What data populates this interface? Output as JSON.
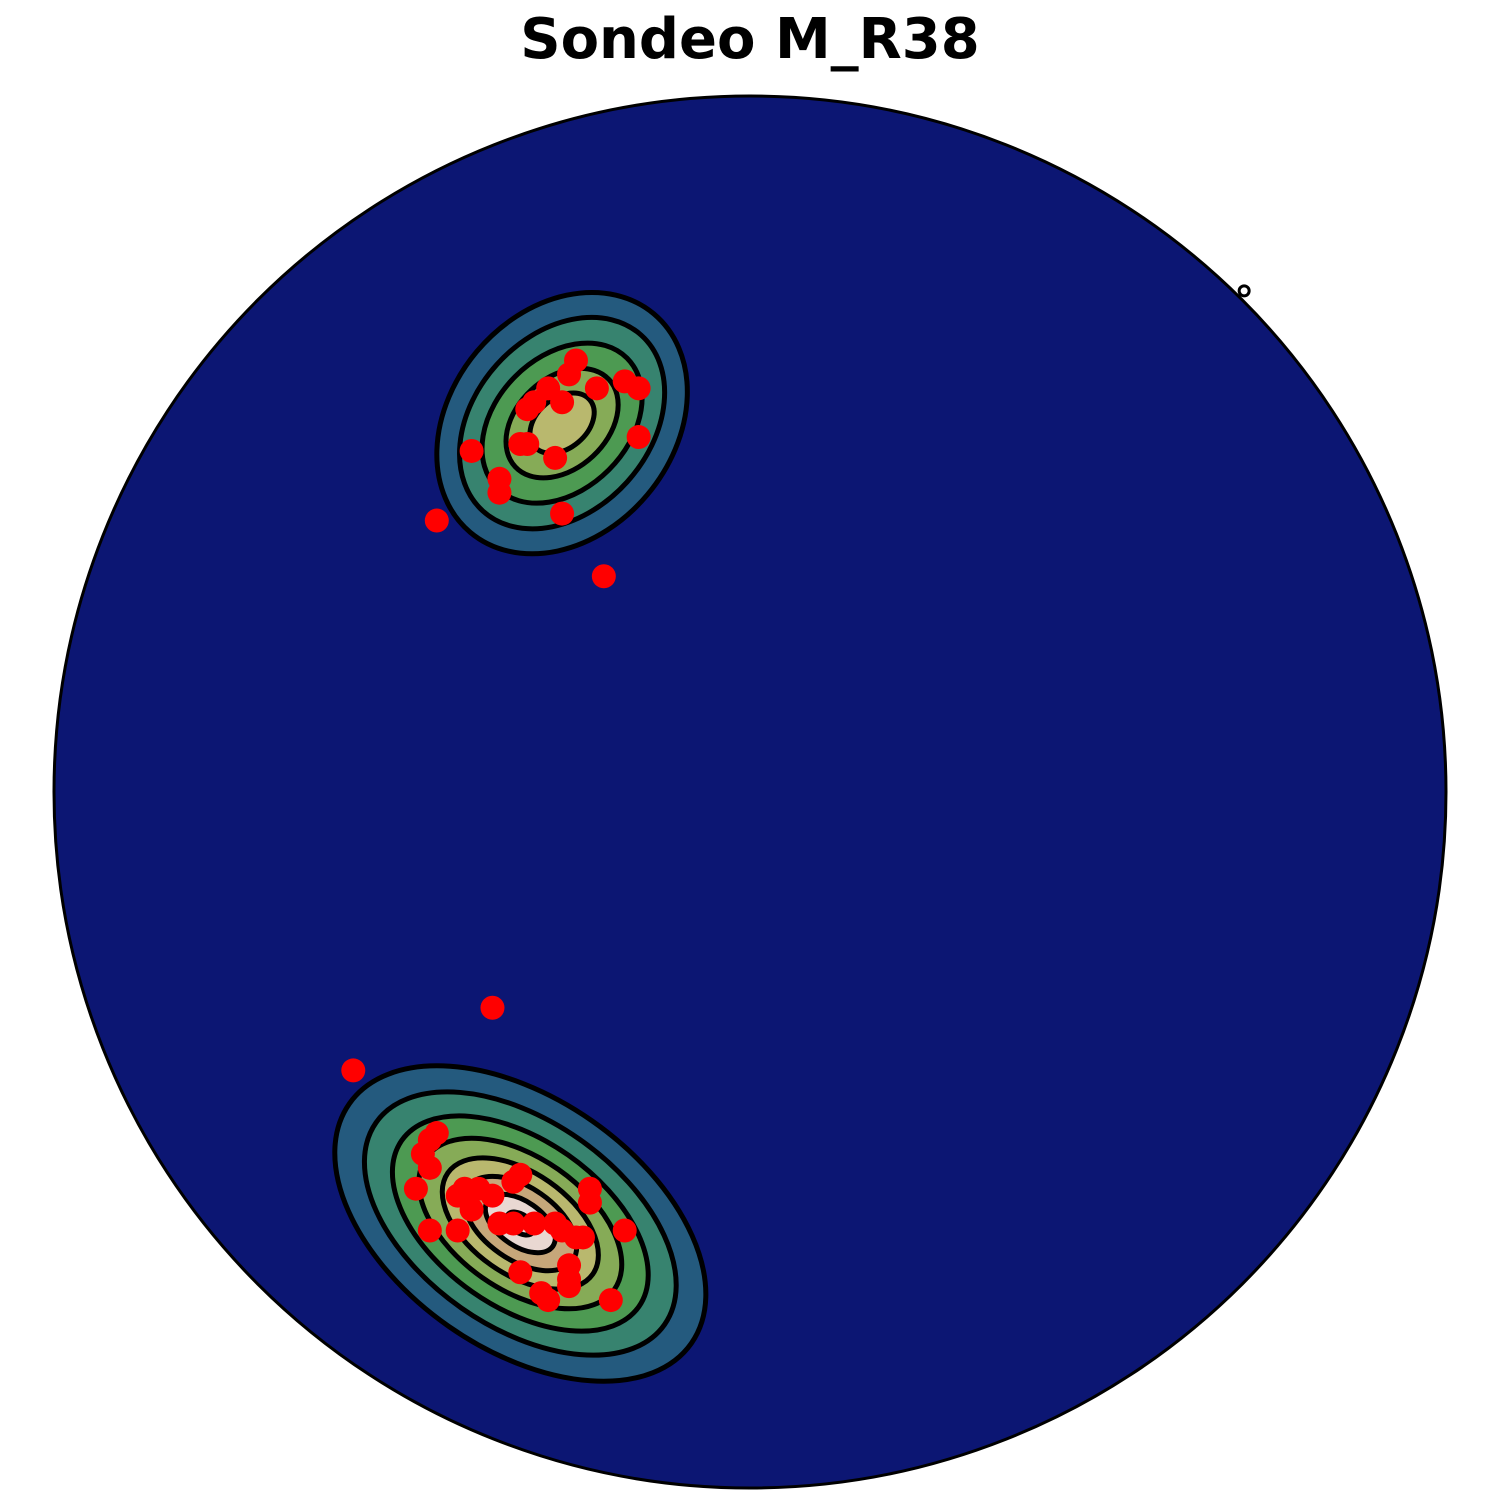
{
  "chart_data": {
    "type": "scatter",
    "projection": "stereonet",
    "title": "Sondeo M_R38",
    "xlabel": "",
    "ylabel": "",
    "xlim": [
      -1,
      1
    ],
    "ylim": [
      -1,
      1
    ],
    "grid": false,
    "legend": "none",
    "colors": {
      "background": "#0c1673",
      "poles": "#ff0000",
      "contour_line": "#000000",
      "net_outline": "#000000",
      "density_levels": [
        "#0c1673",
        "#245a7e",
        "#37836f",
        "#4d9a52",
        "#86ab57",
        "#b9b86e",
        "#c6a77a",
        "#e9d8d2"
      ]
    },
    "north_marker": {
      "x": 0.71,
      "y": 0.72
    },
    "density_clusters": [
      {
        "name": "cluster-north",
        "center": [
          -0.27,
          0.53
        ],
        "levels": [
          {
            "rx": 0.205,
            "ry": 0.16,
            "rot": -50
          },
          {
            "rx": 0.17,
            "ry": 0.126,
            "rot": -48
          },
          {
            "rx": 0.132,
            "ry": 0.095,
            "rot": -45
          },
          {
            "rx": 0.092,
            "ry": 0.065,
            "rot": -43
          },
          {
            "rx": 0.052,
            "ry": 0.036,
            "rot": -40
          }
        ]
      },
      {
        "name": "cluster-south",
        "center": [
          -0.33,
          -0.62
        ],
        "levels": [
          {
            "rx": 0.3,
            "ry": 0.18,
            "rot": 35
          },
          {
            "rx": 0.253,
            "ry": 0.148,
            "rot": 35
          },
          {
            "rx": 0.208,
            "ry": 0.12,
            "rot": 35
          },
          {
            "rx": 0.165,
            "ry": 0.095,
            "rot": 35
          },
          {
            "rx": 0.127,
            "ry": 0.073,
            "rot": 35
          },
          {
            "rx": 0.092,
            "ry": 0.052,
            "rot": 35
          },
          {
            "rx": 0.057,
            "ry": 0.032,
            "rot": 35
          },
          {
            "rx": 0.022,
            "ry": 0.013,
            "rot": 35
          }
        ]
      }
    ],
    "points": [
      {
        "x": -0.25,
        "y": 0.62
      },
      {
        "x": -0.26,
        "y": 0.6
      },
      {
        "x": -0.29,
        "y": 0.58
      },
      {
        "x": -0.31,
        "y": 0.56
      },
      {
        "x": -0.32,
        "y": 0.55
      },
      {
        "x": -0.27,
        "y": 0.56
      },
      {
        "x": -0.22,
        "y": 0.58
      },
      {
        "x": -0.18,
        "y": 0.59
      },
      {
        "x": -0.16,
        "y": 0.58
      },
      {
        "x": -0.16,
        "y": 0.51
      },
      {
        "x": -0.32,
        "y": 0.5
      },
      {
        "x": -0.33,
        "y": 0.5
      },
      {
        "x": -0.4,
        "y": 0.49
      },
      {
        "x": -0.28,
        "y": 0.48
      },
      {
        "x": -0.36,
        "y": 0.45
      },
      {
        "x": -0.36,
        "y": 0.43
      },
      {
        "x": -0.27,
        "y": 0.4
      },
      {
        "x": -0.45,
        "y": 0.39
      },
      {
        "x": -0.21,
        "y": 0.31
      },
      {
        "x": -0.37,
        "y": -0.31
      },
      {
        "x": -0.57,
        "y": -0.4
      },
      {
        "x": -0.45,
        "y": -0.49
      },
      {
        "x": -0.46,
        "y": -0.5
      },
      {
        "x": -0.47,
        "y": -0.52
      },
      {
        "x": -0.46,
        "y": -0.54
      },
      {
        "x": -0.48,
        "y": -0.57
      },
      {
        "x": -0.41,
        "y": -0.57
      },
      {
        "x": -0.39,
        "y": -0.57
      },
      {
        "x": -0.42,
        "y": -0.58
      },
      {
        "x": -0.37,
        "y": -0.58
      },
      {
        "x": -0.33,
        "y": -0.55
      },
      {
        "x": -0.34,
        "y": -0.56
      },
      {
        "x": -0.4,
        "y": -0.6
      },
      {
        "x": -0.36,
        "y": -0.62
      },
      {
        "x": -0.34,
        "y": -0.62
      },
      {
        "x": -0.31,
        "y": -0.62
      },
      {
        "x": -0.28,
        "y": -0.62
      },
      {
        "x": -0.27,
        "y": -0.63
      },
      {
        "x": -0.25,
        "y": -0.64
      },
      {
        "x": -0.24,
        "y": -0.64
      },
      {
        "x": -0.23,
        "y": -0.57
      },
      {
        "x": -0.23,
        "y": -0.59
      },
      {
        "x": -0.18,
        "y": -0.63
      },
      {
        "x": -0.46,
        "y": -0.63
      },
      {
        "x": -0.42,
        "y": -0.63
      },
      {
        "x": -0.26,
        "y": -0.68
      },
      {
        "x": -0.26,
        "y": -0.7
      },
      {
        "x": -0.33,
        "y": -0.69
      },
      {
        "x": -0.26,
        "y": -0.71
      },
      {
        "x": -0.3,
        "y": -0.72
      },
      {
        "x": -0.29,
        "y": -0.73
      },
      {
        "x": -0.2,
        "y": -0.73
      }
    ]
  }
}
